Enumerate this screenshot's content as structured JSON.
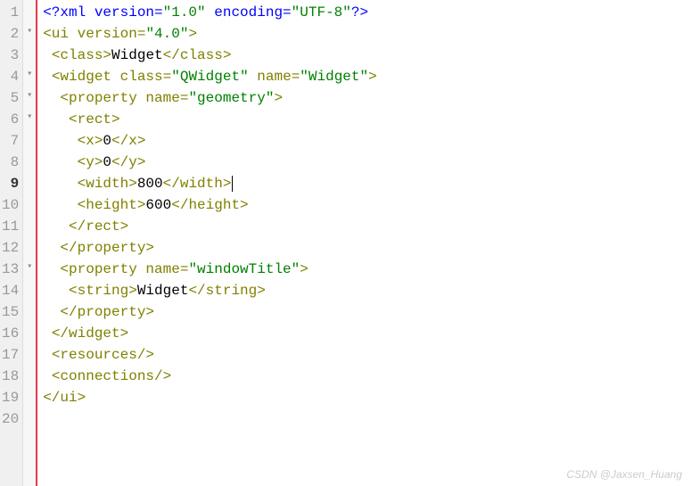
{
  "current_line": 9,
  "lines": [
    {
      "num": 1,
      "fold": "",
      "indent": 0,
      "segments": [
        {
          "cls": "pi",
          "t": "<?xml version="
        },
        {
          "cls": "attr-value",
          "t": "\"1.0\""
        },
        {
          "cls": "pi",
          "t": " encoding="
        },
        {
          "cls": "attr-value",
          "t": "\"UTF-8\""
        },
        {
          "cls": "pi",
          "t": "?>"
        }
      ]
    },
    {
      "num": 2,
      "fold": "▾",
      "indent": 0,
      "segments": [
        {
          "cls": "tag",
          "t": "<ui "
        },
        {
          "cls": "attr-name",
          "t": "version"
        },
        {
          "cls": "tag",
          "t": "="
        },
        {
          "cls": "attr-value",
          "t": "\"4.0\""
        },
        {
          "cls": "tag",
          "t": ">"
        }
      ]
    },
    {
      "num": 3,
      "fold": "",
      "indent": 1,
      "segments": [
        {
          "cls": "tag",
          "t": "<class>"
        },
        {
          "cls": "text",
          "t": "Widget"
        },
        {
          "cls": "tag",
          "t": "</class>"
        }
      ]
    },
    {
      "num": 4,
      "fold": "▾",
      "indent": 1,
      "segments": [
        {
          "cls": "tag",
          "t": "<widget "
        },
        {
          "cls": "attr-name",
          "t": "class"
        },
        {
          "cls": "tag",
          "t": "="
        },
        {
          "cls": "attr-value",
          "t": "\"QWidget\""
        },
        {
          "cls": "tag",
          "t": " "
        },
        {
          "cls": "attr-name",
          "t": "name"
        },
        {
          "cls": "tag",
          "t": "="
        },
        {
          "cls": "attr-value",
          "t": "\"Widget\""
        },
        {
          "cls": "tag",
          "t": ">"
        }
      ]
    },
    {
      "num": 5,
      "fold": "▾",
      "indent": 2,
      "segments": [
        {
          "cls": "tag",
          "t": "<property "
        },
        {
          "cls": "attr-name",
          "t": "name"
        },
        {
          "cls": "tag",
          "t": "="
        },
        {
          "cls": "attr-value",
          "t": "\"geometry\""
        },
        {
          "cls": "tag",
          "t": ">"
        }
      ]
    },
    {
      "num": 6,
      "fold": "▾",
      "indent": 3,
      "segments": [
        {
          "cls": "tag",
          "t": "<rect>"
        }
      ]
    },
    {
      "num": 7,
      "fold": "",
      "indent": 4,
      "segments": [
        {
          "cls": "tag",
          "t": "<x>"
        },
        {
          "cls": "text",
          "t": "0"
        },
        {
          "cls": "tag",
          "t": "</x>"
        }
      ]
    },
    {
      "num": 8,
      "fold": "",
      "indent": 4,
      "segments": [
        {
          "cls": "tag",
          "t": "<y>"
        },
        {
          "cls": "text",
          "t": "0"
        },
        {
          "cls": "tag",
          "t": "</y>"
        }
      ]
    },
    {
      "num": 9,
      "fold": "",
      "indent": 4,
      "segments": [
        {
          "cls": "tag",
          "t": "<width>"
        },
        {
          "cls": "text",
          "t": "800"
        },
        {
          "cls": "tag",
          "t": "</width>"
        }
      ],
      "cursor_after": true
    },
    {
      "num": 10,
      "fold": "",
      "indent": 4,
      "segments": [
        {
          "cls": "tag",
          "t": "<height>"
        },
        {
          "cls": "text",
          "t": "600"
        },
        {
          "cls": "tag",
          "t": "</height>"
        }
      ]
    },
    {
      "num": 11,
      "fold": "",
      "indent": 3,
      "segments": [
        {
          "cls": "tag",
          "t": "</rect>"
        }
      ]
    },
    {
      "num": 12,
      "fold": "",
      "indent": 2,
      "segments": [
        {
          "cls": "tag",
          "t": "</property>"
        }
      ]
    },
    {
      "num": 13,
      "fold": "▾",
      "indent": 2,
      "segments": [
        {
          "cls": "tag",
          "t": "<property "
        },
        {
          "cls": "attr-name",
          "t": "name"
        },
        {
          "cls": "tag",
          "t": "="
        },
        {
          "cls": "attr-value",
          "t": "\"windowTitle\""
        },
        {
          "cls": "tag",
          "t": ">"
        }
      ]
    },
    {
      "num": 14,
      "fold": "",
      "indent": 3,
      "segments": [
        {
          "cls": "tag",
          "t": "<string>"
        },
        {
          "cls": "text",
          "t": "Widget"
        },
        {
          "cls": "tag",
          "t": "</string>"
        }
      ]
    },
    {
      "num": 15,
      "fold": "",
      "indent": 2,
      "segments": [
        {
          "cls": "tag",
          "t": "</property>"
        }
      ]
    },
    {
      "num": 16,
      "fold": "",
      "indent": 1,
      "segments": [
        {
          "cls": "tag",
          "t": "</widget>"
        }
      ]
    },
    {
      "num": 17,
      "fold": "",
      "indent": 1,
      "segments": [
        {
          "cls": "tag",
          "t": "<resources/>"
        }
      ]
    },
    {
      "num": 18,
      "fold": "",
      "indent": 1,
      "segments": [
        {
          "cls": "tag",
          "t": "<connections/>"
        }
      ]
    },
    {
      "num": 19,
      "fold": "",
      "indent": 0,
      "segments": [
        {
          "cls": "tag",
          "t": "</ui>"
        }
      ]
    },
    {
      "num": 20,
      "fold": "",
      "indent": 0,
      "segments": []
    }
  ],
  "watermark": "CSDN @Jaxsen_Huang"
}
